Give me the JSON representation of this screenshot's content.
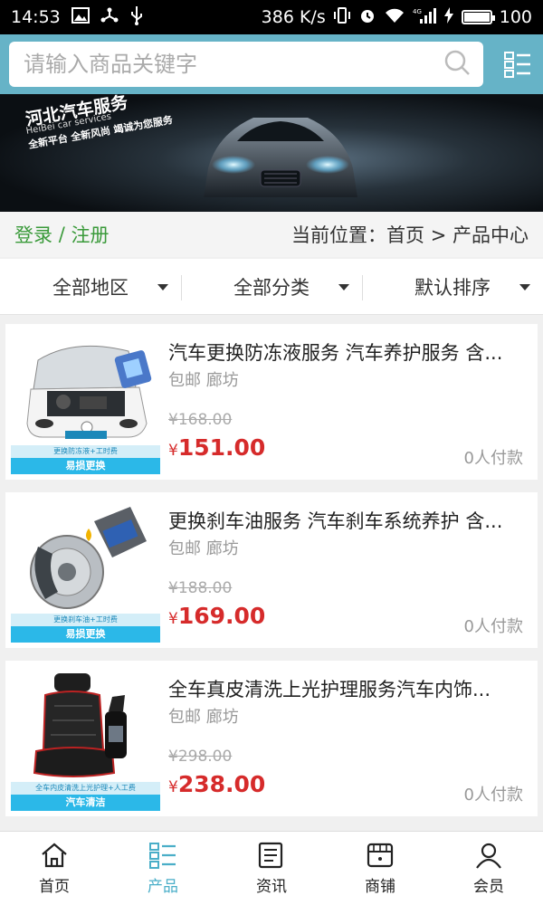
{
  "statusbar": {
    "time": "14:53",
    "speed": "386 K/s",
    "network": "4G",
    "battery": "100"
  },
  "search": {
    "placeholder": "请输入商品关键字"
  },
  "banner": {
    "title": "河北汽车服务",
    "subtitle": "HeiBei car services",
    "slogan": "全新平台 全新风尚 竭诚为您服务"
  },
  "userbar": {
    "login": "登录",
    "separator": "/",
    "register": "注册",
    "location": "当前位置：首页 > 产品中心"
  },
  "filters": [
    {
      "label": "全部地区"
    },
    {
      "label": "全部分类"
    },
    {
      "label": "默认排序"
    }
  ],
  "products": [
    {
      "title": "汽车更换防冻液服务 汽车养护服务 含...",
      "tags": "包邮 廊坊",
      "old_price": "¥168.00",
      "price": "151.00",
      "currency": "¥",
      "paid": "0人付款",
      "caption_small": "更换防冻液+工时费",
      "caption_big": "易损更换"
    },
    {
      "title": "更换刹车油服务 汽车刹车系统养护 含...",
      "tags": "包邮 廊坊",
      "old_price": "¥188.00",
      "price": "169.00",
      "currency": "¥",
      "paid": "0人付款",
      "caption_small": "更换刹车油+工时费",
      "caption_big": "易损更换"
    },
    {
      "title": "全车真皮清洗上光护理服务汽车内饰...",
      "tags": "包邮 廊坊",
      "old_price": "¥298.00",
      "price": "238.00",
      "currency": "¥",
      "paid": "0人付款",
      "caption_small": "全车内皮清洗上光护理+人工费",
      "caption_big": "汽车清洁"
    }
  ],
  "tabs": [
    {
      "label": "首页",
      "icon": "home-icon"
    },
    {
      "label": "产品",
      "icon": "product-list-icon",
      "active": true
    },
    {
      "label": "资讯",
      "icon": "news-icon"
    },
    {
      "label": "商铺",
      "icon": "shop-icon"
    },
    {
      "label": "会员",
      "icon": "member-icon"
    }
  ],
  "colors": {
    "header": "#66b3c7",
    "accent": "#4aaec8",
    "price": "#d62b2b",
    "login": "#3a9a3a"
  }
}
